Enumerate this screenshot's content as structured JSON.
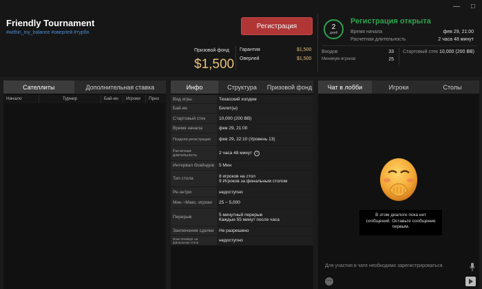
{
  "header": {
    "title": "Friendly Tournament",
    "tags": "#within_my_balance #оверлей #турбо",
    "register_label": "Регистрация",
    "prize_label": "Призовой фонд",
    "prize_value": "$1,500",
    "guarantee_label": "Гарантия",
    "guarantee_value": "$1,500",
    "overlay_label": "Оверлей",
    "overlay_value": "$1,500",
    "days_number": "2",
    "days_label": "дней",
    "reg_status": "Регистрация открыта",
    "start_label": "Время начала",
    "start_value": "фев 29, 21:00",
    "duration_label": "Расчетная длительность",
    "duration_value": "2 часа 48 минут",
    "entries_label": "Входов",
    "entries_value": "33",
    "min_players_label": "Минимум игроков",
    "min_players_value": "25",
    "stack_label": "Стартовый стек",
    "stack_value": "10,000 (200 BB)",
    "window_controls": [
      "—",
      "□"
    ]
  },
  "left": {
    "tabs": [
      "Сателлиты",
      "Дополнительная ставка"
    ],
    "columns": [
      "Начало",
      "Турнир",
      "Бай-ин",
      "Игроки",
      "Приз"
    ]
  },
  "mid": {
    "tabs": [
      "Инфо",
      "Структура",
      "Призовой фонд"
    ],
    "rows": [
      {
        "k": "Вид игры",
        "v": "Техасский холдем"
      },
      {
        "k": "Бай-ин",
        "v": "Билет(ы)"
      },
      {
        "k": "Стартовый стек",
        "v": "10,000 (200 BB)"
      },
      {
        "k": "Время начала",
        "v": "фев 29, 21:00"
      },
      {
        "k": "Поздняя регистрация",
        "v": "фев 29, 22:10 (Уровень 13)"
      },
      {
        "k": "Расчетная длительность",
        "v": "2 часа 48 минут"
      },
      {
        "k": "Интервал блайндов",
        "v": "5 Мин"
      },
      {
        "k": "Тип стола",
        "v": "8 игроков на стол",
        "v2": "9 Игроков за финальным столом"
      },
      {
        "k": "Ре-энтри",
        "v": "недоступно"
      },
      {
        "k": "Мин.~Макс. игроки",
        "v": "25 ~ 5,000"
      },
      {
        "k": "Перерыв",
        "v": "5 минутный перерыв",
        "v2": "Каждые 55 минут после часа"
      },
      {
        "k": "Заключение сделки",
        "v": "Не разрешено"
      },
      {
        "k": "Флип Флейорт на финальном столе",
        "v": "недоступно"
      }
    ]
  },
  "right": {
    "tabs": [
      "Чат в лобби",
      "Игроки",
      "Столы"
    ],
    "chat_empty": "В этом диалоге пока нет сообщений. Оставьте сообщение первым.",
    "chat_input_placeholder": "Для участия в чате необходимо зарегистрироваться."
  },
  "colors": {
    "accent_green": "#2ea44f",
    "register_red": "#b03636",
    "gold": "#e8c27b",
    "tag_blue": "#4f8fd8"
  }
}
